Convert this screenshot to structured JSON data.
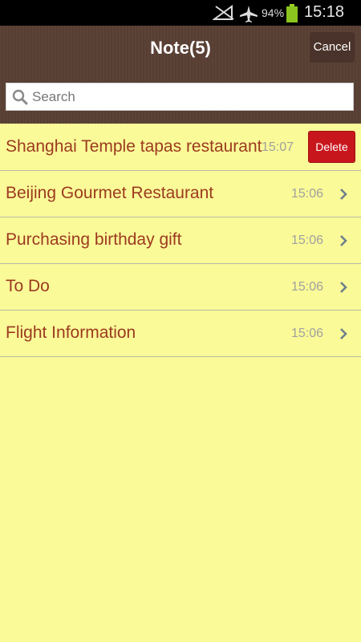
{
  "status_bar": {
    "battery_percent": "94%",
    "time": "15:18",
    "icons": [
      "signal-off-icon",
      "airplane-mode-icon",
      "battery-icon"
    ]
  },
  "header": {
    "title": "Note(5)",
    "cancel_label": "Cancel"
  },
  "search": {
    "placeholder": "Search",
    "value": ""
  },
  "notes": [
    {
      "title": "Shanghai Temple tapas restaurant",
      "time": "15:07",
      "delete_label": "Delete"
    },
    {
      "title": "Beijing Gourmet Restaurant",
      "time": "15:06"
    },
    {
      "title": "Purchasing birthday gift",
      "time": "15:06"
    },
    {
      "title": "To Do",
      "time": "15:06"
    },
    {
      "title": "Flight Information",
      "time": "15:06"
    }
  ],
  "colors": {
    "background": "#fafa98",
    "header": "#5a4034",
    "note_text": "#9c3a20",
    "delete": "#c8161d"
  }
}
